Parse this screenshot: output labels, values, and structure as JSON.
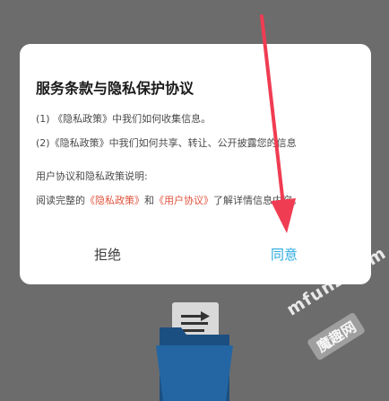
{
  "dialog": {
    "title": "服务条款与隐私保护协议",
    "line1": "(1) 《隐私政策》中我们如何收集信息。",
    "line2": "(2)《隐私政策》中我们如何共享、转让、公开披露您的信息",
    "line3": "用户协议和隐私政策说明:",
    "line4_prefix": "阅读完整的",
    "privacy_link": "《隐私政策》",
    "line4_and": "和",
    "user_agreement_link": "《用户协议》",
    "line4_suffix": "了解详情信息内容。",
    "reject_label": "拒绝",
    "agree_label": "同意"
  },
  "watermark": {
    "text": "mfunz.com",
    "cn": "魔趣网"
  },
  "colors": {
    "overlay": "#6c6c6c",
    "link": "#e0533d",
    "agree": "#29a9e0",
    "arrow": "#f03c52",
    "folder": "#1f5a93"
  },
  "icons": {
    "annotation_arrow": "arrow-down-icon",
    "folder": "folder-document-icon"
  }
}
